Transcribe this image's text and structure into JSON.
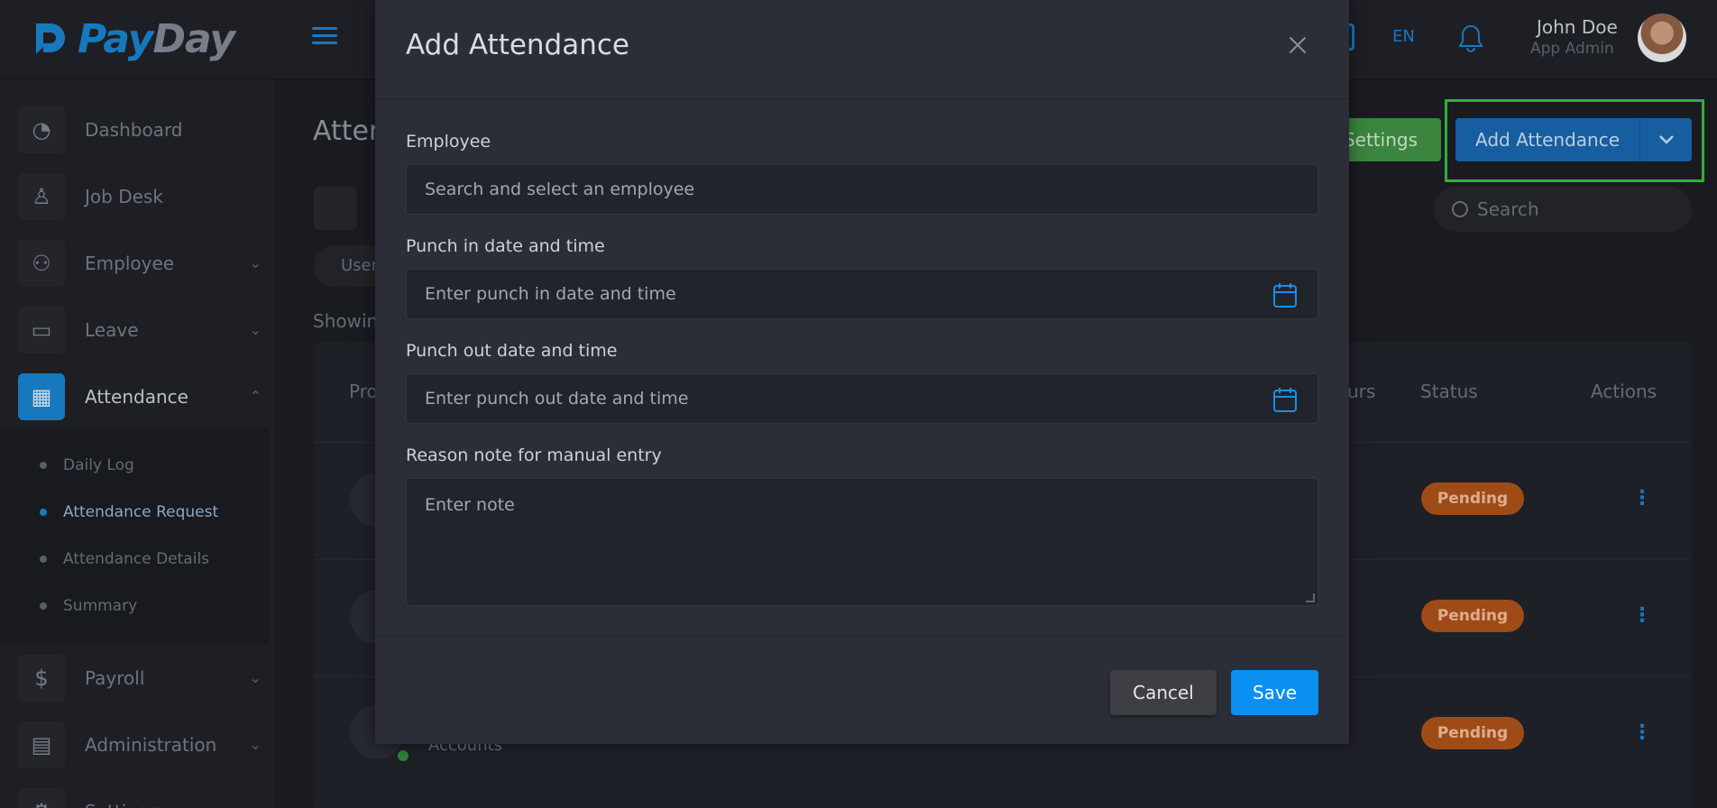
{
  "brand": {
    "name_part1": "Pay",
    "name_part2": "Day"
  },
  "topbar": {
    "language": "EN",
    "user_name": "John Doe",
    "user_role": "App Admin"
  },
  "sidebar": {
    "items": [
      {
        "label": "Dashboard",
        "icon": "pie-chart-icon"
      },
      {
        "label": "Job Desk",
        "icon": "user-icon"
      },
      {
        "label": "Employee",
        "icon": "users-icon"
      },
      {
        "label": "Leave",
        "icon": "clipboard-icon"
      },
      {
        "label": "Attendance",
        "icon": "calendar-icon"
      },
      {
        "label": "Payroll",
        "icon": "dollar-icon"
      },
      {
        "label": "Administration",
        "icon": "briefcase-icon"
      },
      {
        "label": "Settings",
        "icon": "gear-icon"
      }
    ],
    "attendance_submenu": [
      "Daily Log",
      "Attendance Request",
      "Attendance Details",
      "Summary"
    ],
    "active_submenu": "Attendance Request"
  },
  "page": {
    "title_partial": "Atten",
    "settings_button": "Settings",
    "add_button": "Add Attendance",
    "search_placeholder": "Search",
    "filter_pill_partial": "User",
    "showing_partial": "Showing",
    "table_headers": {
      "profile_partial": "Pro",
      "hours_partial": "urs",
      "status": "Status",
      "actions": "Actions"
    },
    "rows": [
      {
        "status": "Pending"
      },
      {
        "status": "Pending"
      },
      {
        "status": "Pending",
        "department": "Accounts"
      }
    ]
  },
  "modal": {
    "title": "Add Attendance",
    "employee_label": "Employee",
    "employee_placeholder": "Search and select an employee",
    "punch_in_label": "Punch in date and time",
    "punch_in_placeholder": "Enter punch in date and time",
    "punch_out_label": "Punch out date and time",
    "punch_out_placeholder": "Enter punch out date and time",
    "note_label": "Reason note for manual entry",
    "note_placeholder": "Enter note",
    "cancel_label": "Cancel",
    "save_label": "Save"
  },
  "colors": {
    "accent": "#1a7fc9",
    "save_button": "#0b8ff0",
    "settings_button": "#3f8d42",
    "pending_badge": "#a8501a",
    "highlight_box": "#2ebd3a"
  }
}
